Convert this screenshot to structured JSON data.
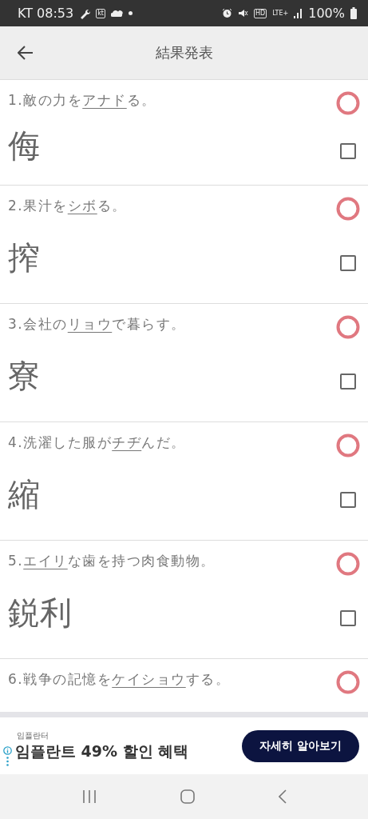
{
  "status_bar": {
    "carrier_time": "KT 08:53",
    "badges": [
      "kt",
      "HD",
      "LTE+"
    ],
    "battery": "100%"
  },
  "app_bar": {
    "title": "結果発表"
  },
  "questions": [
    {
      "number": "1.",
      "before": "敵の力を",
      "reading": "アナド",
      "after": "る。",
      "answer": "侮",
      "correct": true,
      "checked": false
    },
    {
      "number": "2.",
      "before": "果汁を",
      "reading": "シボ",
      "after": "る。",
      "answer": "搾",
      "correct": true,
      "checked": false
    },
    {
      "number": "3.",
      "before": "会社の",
      "reading": "リョウ",
      "after": "で暮らす。",
      "answer": "寮",
      "correct": true,
      "checked": false
    },
    {
      "number": "4.",
      "before": "洗濯した服が",
      "reading": "チヂ",
      "after": "んだ。",
      "answer": "縮",
      "correct": true,
      "checked": false
    },
    {
      "number": "5.",
      "reading": "エイリ",
      "after": "な歯を持つ肉食動物。",
      "answer": "鋭利",
      "correct": true,
      "checked": false
    },
    {
      "number": "6.",
      "before": "戦争の記憶を",
      "reading": "ケイショウ",
      "after": "する。",
      "correct": true
    }
  ],
  "ad": {
    "advertiser": "임플란터",
    "headline": "임플란트 49% 할인 혜택",
    "cta": "자세히 알아보기"
  }
}
